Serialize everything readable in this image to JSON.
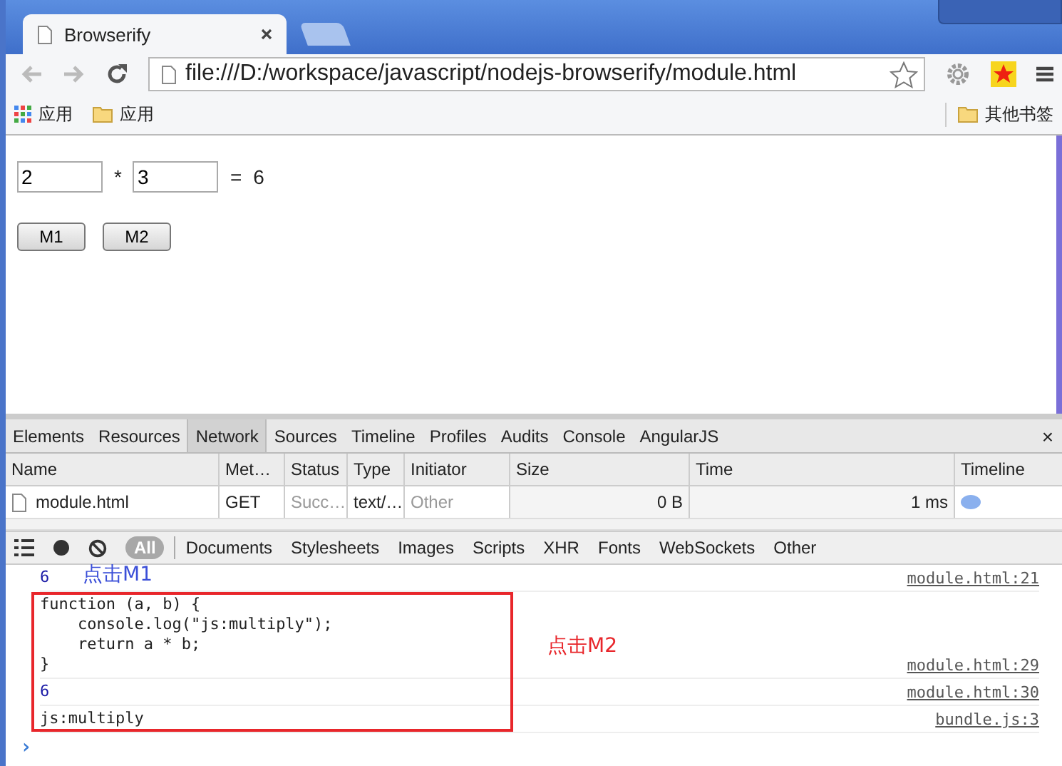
{
  "browser": {
    "tab_title": "Browserify",
    "address": "file:///D:/workspace/javascript/nodejs-browserify/module.html",
    "bookmarks": [
      "应用",
      "应用"
    ],
    "other_bookmarks": "其他书签"
  },
  "page": {
    "input_a": "2",
    "operator": "*",
    "input_b": "3",
    "equals": "=",
    "result": "6",
    "buttons": [
      "M1",
      "M2"
    ]
  },
  "devtools": {
    "tabs": [
      {
        "label": "Elements",
        "selected": false
      },
      {
        "label": "Resources",
        "selected": false
      },
      {
        "label": "Network",
        "selected": true
      },
      {
        "label": "Sources",
        "selected": false
      },
      {
        "label": "Timeline",
        "selected": false
      },
      {
        "label": "Profiles",
        "selected": false
      },
      {
        "label": "Audits",
        "selected": false
      },
      {
        "label": "Console",
        "selected": false
      },
      {
        "label": "AngularJS",
        "selected": false
      }
    ],
    "close": "×",
    "network": {
      "columns": [
        "Name",
        "Met…",
        "Status",
        "Type",
        "Initiator",
        "Size",
        "Time",
        "Timeline"
      ],
      "rows": [
        {
          "name": "module.html",
          "method": "GET",
          "status": "Succ…",
          "type": "text/…",
          "initiator": "Other",
          "size": "0 B",
          "time": "1 ms"
        }
      ]
    },
    "filters": [
      {
        "label": "All",
        "selected": true
      },
      {
        "label": "Documents",
        "selected": false
      },
      {
        "label": "Stylesheets",
        "selected": false
      },
      {
        "label": "Images",
        "selected": false
      },
      {
        "label": "Scripts",
        "selected": false
      },
      {
        "label": "XHR",
        "selected": false
      },
      {
        "label": "Fonts",
        "selected": false
      },
      {
        "label": "WebSockets",
        "selected": false
      },
      {
        "label": "Other",
        "selected": false
      }
    ],
    "console": [
      {
        "kind": "number",
        "text": "6",
        "source": "module.html:21"
      },
      {
        "kind": "text",
        "text": "function (a, b) {\n    console.log(\"js:multiply\");\n    return a * b;\n}",
        "source": "module.html:29"
      },
      {
        "kind": "number",
        "text": "6",
        "source": "module.html:30"
      },
      {
        "kind": "text",
        "text": "js:multiply",
        "source": "bundle.js:3"
      }
    ],
    "prompt": "›"
  },
  "annotations": [
    {
      "text": "点击M1",
      "color": "#3b4fd8"
    },
    {
      "text": "点击M2",
      "color": "#e8262b"
    }
  ]
}
